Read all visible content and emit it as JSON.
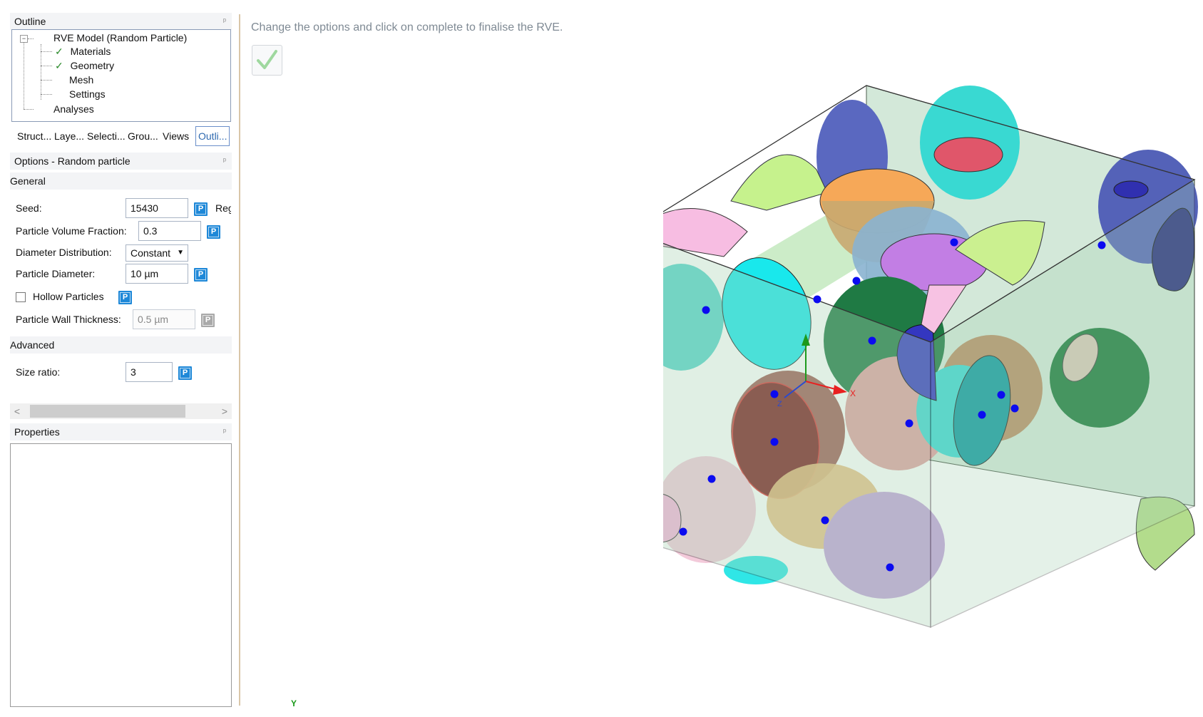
{
  "outline": {
    "title": "Outline",
    "pin": "ᵖ",
    "tree": {
      "root": "RVE Model (Random Particle)",
      "expander": "−",
      "children": [
        {
          "label": "Materials",
          "checked": "✓"
        },
        {
          "label": "Geometry",
          "checked": "✓"
        },
        {
          "label": "Mesh",
          "checked": ""
        },
        {
          "label": "Settings",
          "checked": ""
        }
      ],
      "sibling": "Analyses"
    },
    "tabs": [
      "Struct...",
      "Laye...",
      "Selecti...",
      "Grou...",
      "Views",
      "Outli..."
    ]
  },
  "options": {
    "title": "Options - Random particle",
    "pin": "ᵖ",
    "general": {
      "title": "General",
      "seed_label": "Seed:",
      "seed_value": "15430",
      "seed_extra": "Reg",
      "volume_fraction_label": "Particle Volume Fraction:",
      "volume_fraction_value": "0.3",
      "distribution_label": "Diameter Distribution:",
      "distribution_value": "Constant",
      "diameter_label": "Particle Diameter:",
      "diameter_value": "10 µm",
      "hollow_label": "Hollow Particles",
      "wall_label": "Particle Wall Thickness:",
      "wall_value": "0.5 µm"
    },
    "advanced": {
      "title": "Advanced",
      "size_ratio_label": "Size ratio:",
      "size_ratio_value": "3"
    },
    "p_badge": "P"
  },
  "scrollbar": {
    "left": "<",
    "right": ">"
  },
  "properties": {
    "title": "Properties",
    "pin": "ᵖ"
  },
  "viewport": {
    "instruction": "Change the options and click on complete to finalise the RVE.",
    "complete_icon": "✓",
    "axis_x": "X",
    "axis_z": "Z",
    "bottom_axis": "Y",
    "colors": {
      "box_fill": "#bcdcc6",
      "cyan": "#2fe6e6",
      "pink": "#f6b7de",
      "orange": "#f6a55b",
      "purple": "#c47ee6",
      "navy": "#2f2fb8",
      "darkred": "#7a1e1e",
      "green": "#1f7a3e",
      "lime": "#c4f08a",
      "marker": "#0b0bf0"
    }
  }
}
